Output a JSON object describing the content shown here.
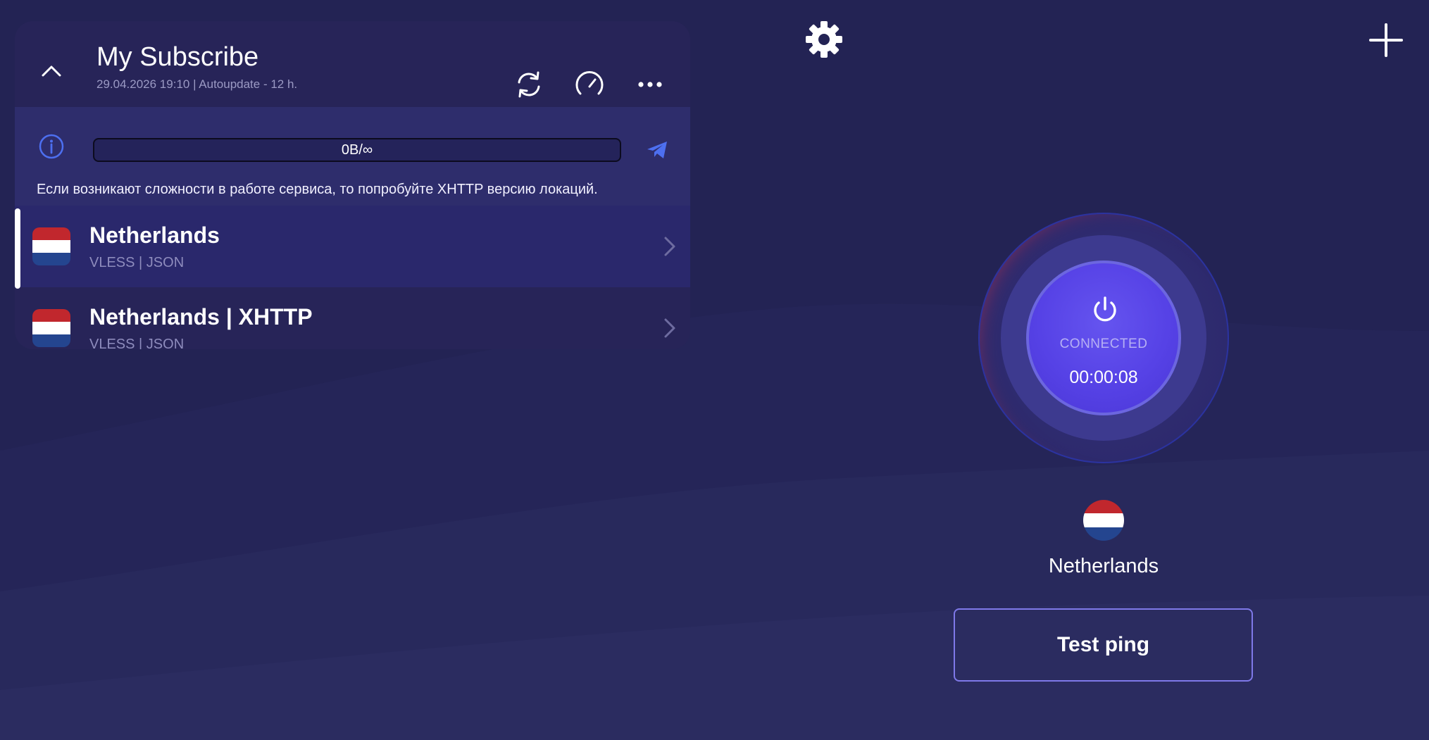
{
  "subscription": {
    "title": "My Subscribe",
    "meta": "29.04.2026 19:10 | Autoupdate - 12 h.",
    "traffic_text": "0B/∞",
    "traffic_used_fraction": 0,
    "notice": "Если возникают сложности в работе сервиса, то попробуйте XHTTP версию локаций.",
    "icons": {
      "collapse": "chevron-up-icon",
      "refresh": "refresh-icon",
      "speed": "speedometer-icon",
      "more": "more-horizontal-icon",
      "info": "info-icon",
      "telegram": "telegram-icon"
    }
  },
  "servers": [
    {
      "name": "Netherlands",
      "protocol": "VLESS | JSON",
      "selected": true,
      "flag": "nl-flag-icon"
    },
    {
      "name": "Netherlands | XHTTP",
      "protocol": "VLESS | JSON",
      "selected": false,
      "flag": "nl-flag-icon"
    }
  ],
  "connection": {
    "status": "CONNECTED",
    "timer": "00:00:08",
    "location": "Netherlands",
    "test_ping_label": "Test ping"
  },
  "top_icons": {
    "settings": "gear-icon",
    "add": "plus-icon"
  },
  "colors": {
    "background": "#232354",
    "panel": "#272458",
    "accent": "#5642e6",
    "info_blue": "#4d6ff0",
    "flag_red": "#c1272d",
    "flag_blue": "#24458f"
  }
}
